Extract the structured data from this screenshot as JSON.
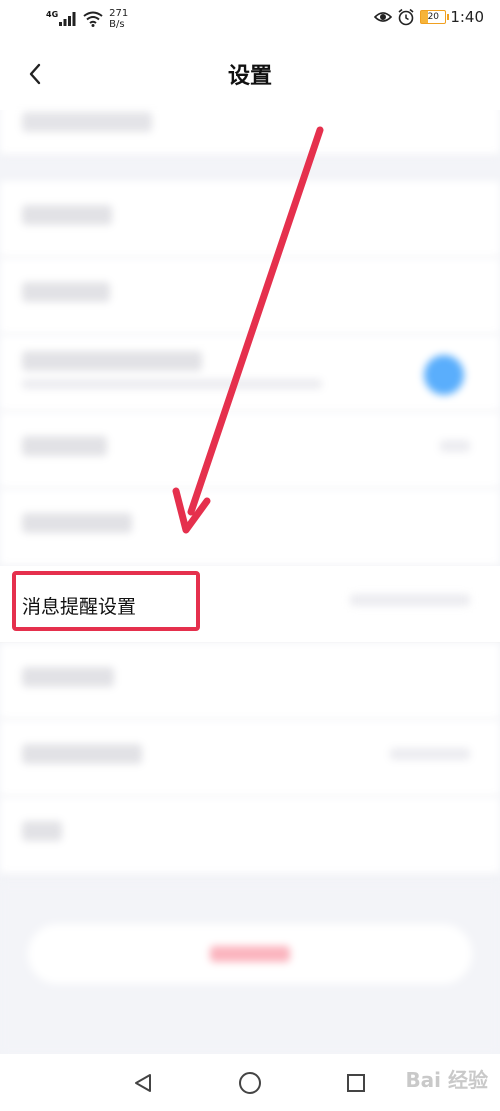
{
  "status_bar": {
    "network": "4G",
    "speed_value": "271",
    "speed_unit": "B/s",
    "battery": "20",
    "time": "1:40"
  },
  "header": {
    "title": "设置"
  },
  "settings": {
    "highlighted_item": "消息提醒设置"
  },
  "watermark": "Bai 经验",
  "colors": {
    "highlight": "#e5304d",
    "toggle_on": "#5aaefc"
  }
}
